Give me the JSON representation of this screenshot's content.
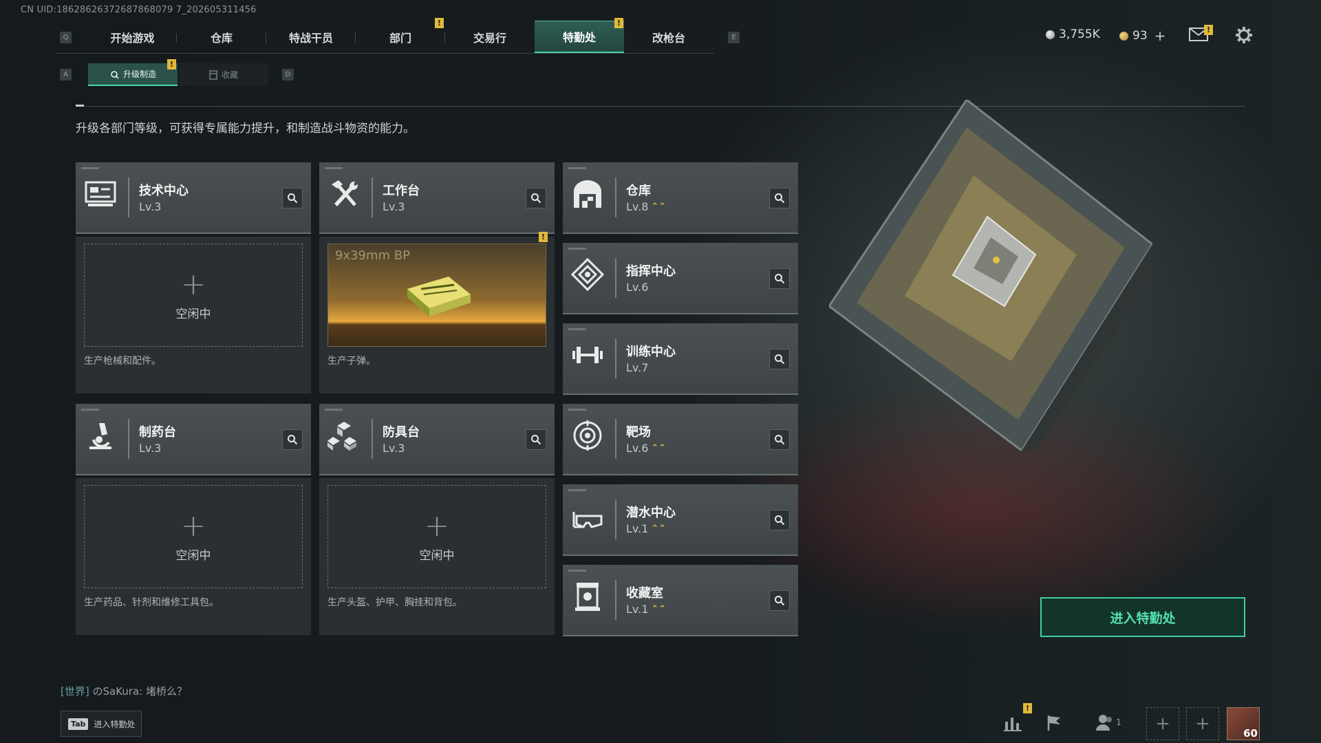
{
  "uid": "CN UID:18628626372687868079 7_202605311456",
  "nav": {
    "left_key": "Q",
    "right_key": "E",
    "tabs": [
      {
        "label": "开始游戏",
        "active": false,
        "alert": false
      },
      {
        "label": "仓库",
        "active": false,
        "alert": false
      },
      {
        "label": "特战干员",
        "active": false,
        "alert": false
      },
      {
        "label": "部门",
        "active": false,
        "alert": true
      },
      {
        "label": "交易行",
        "active": false,
        "alert": false
      },
      {
        "label": "特勤处",
        "active": true,
        "alert": true
      },
      {
        "label": "改枪台",
        "active": false,
        "alert": false
      }
    ],
    "alert_symbol": "!"
  },
  "currency": {
    "silver": "3,755K",
    "gold": "93",
    "plus": "+"
  },
  "subtabs": {
    "left_key": "A",
    "right_key": "D",
    "items": [
      {
        "label": "升级制造",
        "active": true,
        "alert": true
      },
      {
        "label": "收藏",
        "active": false,
        "alert": false
      }
    ]
  },
  "description": "升级各部门等级，可获得专属能力提升，和制造战斗物资的能力。",
  "departments": {
    "tech_center": {
      "name": "技术中心",
      "level": "Lv.3",
      "slot_text": "空闲中",
      "slot_plus": "+",
      "desc": "生产枪械和配件。"
    },
    "workbench": {
      "name": "工作台",
      "level": "Lv.3",
      "product": "9x39mm BP",
      "desc": "生产子弹。"
    },
    "pharmacy": {
      "name": "制药台",
      "level": "Lv.3",
      "slot_text": "空闲中",
      "slot_plus": "+",
      "desc": "生产药品、针剂和维修工具包。"
    },
    "armor_bench": {
      "name": "防具台",
      "level": "Lv.3",
      "slot_text": "空闲中",
      "slot_plus": "+",
      "desc": "生产头盔、护甲、胸挂和背包。"
    },
    "warehouse": {
      "name": "仓库",
      "level": "Lv.8",
      "upgradable": true
    },
    "command_center": {
      "name": "指挥中心",
      "level": "Lv.6",
      "upgradable": false
    },
    "training_center": {
      "name": "训练中心",
      "level": "Lv.7",
      "upgradable": false
    },
    "shooting_range": {
      "name": "靶场",
      "level": "Lv.6",
      "upgradable": true
    },
    "diving_center": {
      "name": "潜水中心",
      "level": "Lv.1",
      "upgradable": true
    },
    "collection_room": {
      "name": "收藏室",
      "level": "Lv.1",
      "upgradable": true
    }
  },
  "up_arrows": "⌃⌃",
  "enter_button": "进入特勤处",
  "chat": {
    "channel": "[世界]",
    "user": "のSaKura:",
    "message": "堵桥么？"
  },
  "tab_hint": {
    "key": "Tab",
    "label": "进入特勤处"
  },
  "bottom_bar": {
    "friends_count": "1",
    "avatar_level": "60",
    "plus": "+"
  },
  "colors": {
    "accent": "#46d6a6",
    "alert": "#e0b93a",
    "upgrade": "#e2b648"
  }
}
